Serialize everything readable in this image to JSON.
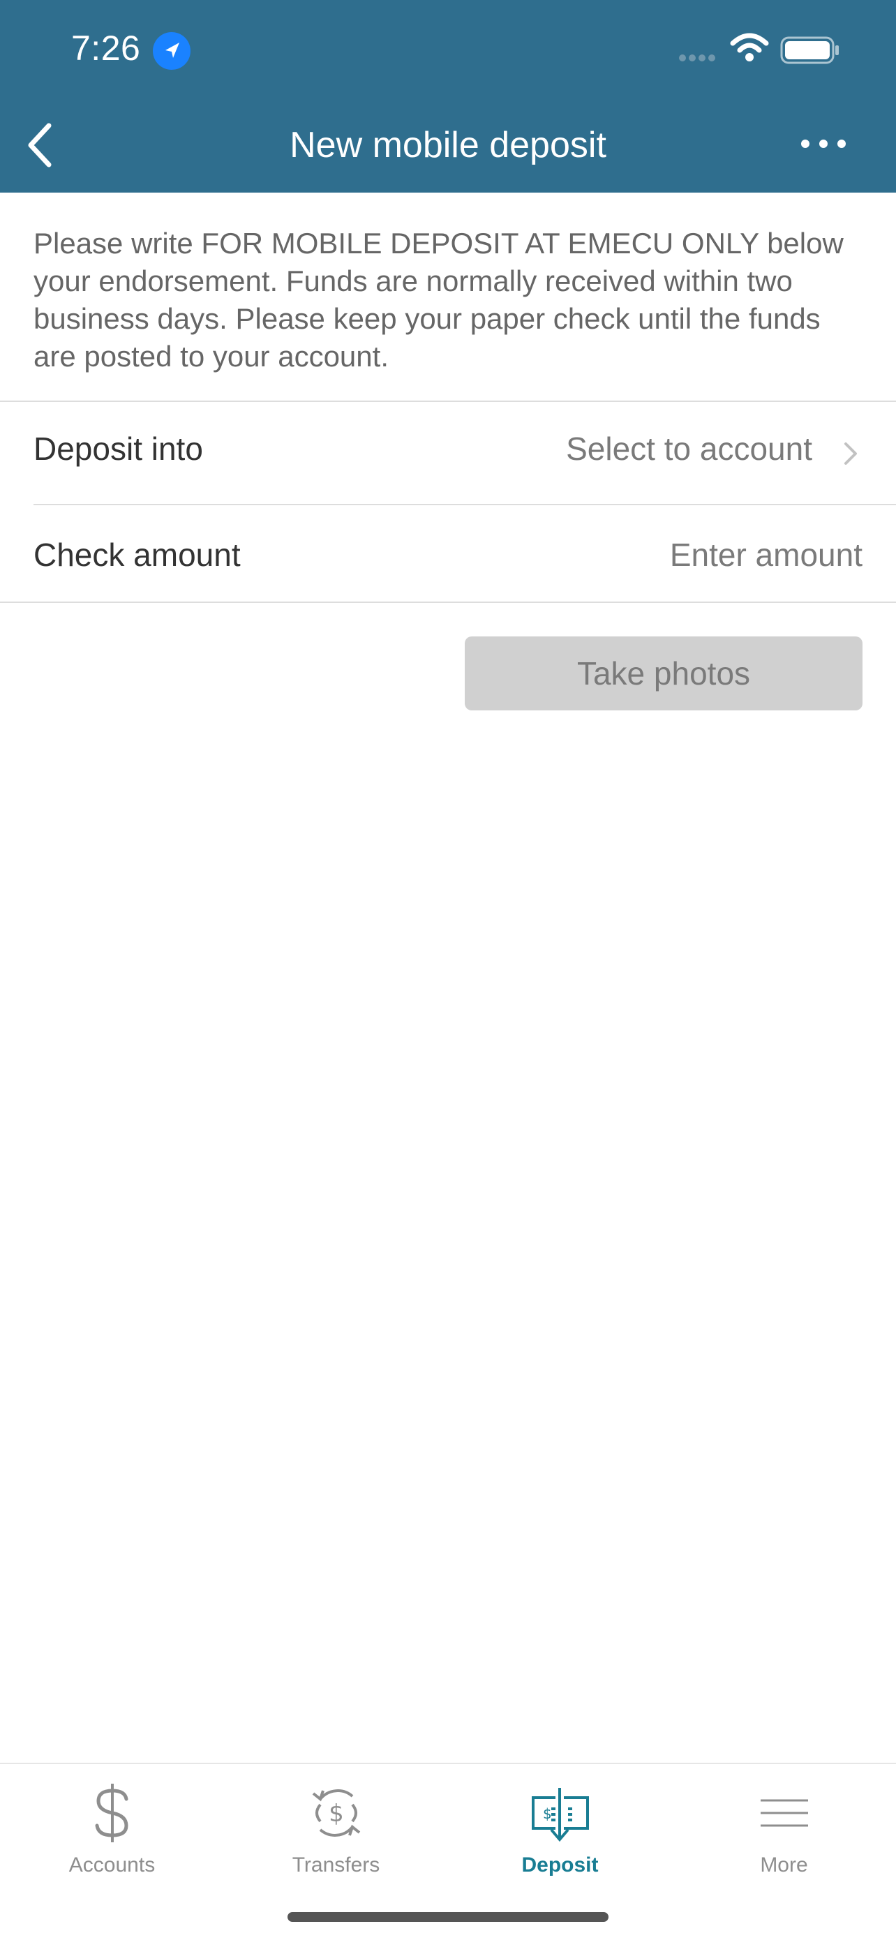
{
  "colors": {
    "brand": "#2f6e8e",
    "active_tab": "#197d93",
    "button_disabled": "#d0d0d0"
  },
  "status_bar": {
    "time": "7:26",
    "icons": [
      "location-arrow-icon",
      "signal-icon",
      "wifi-icon",
      "battery-icon"
    ]
  },
  "header": {
    "title": "New mobile deposit",
    "back_icon": "chevron-left-icon",
    "menu_icon": "ellipsis-icon"
  },
  "notice": {
    "text": "Please write FOR MOBILE DEPOSIT AT EMECU ONLY below your endorsement. Funds are normally received within two business days. Please keep your paper check until the funds are posted to your account."
  },
  "form": {
    "deposit_into": {
      "label": "Deposit into",
      "value": "Select to account"
    },
    "check_amount": {
      "label": "Check amount",
      "placeholder": "Enter amount"
    }
  },
  "actions": {
    "take_photos": "Take photos"
  },
  "tabbar": {
    "tabs": [
      {
        "label": "Accounts",
        "icon": "dollar-icon",
        "active": false
      },
      {
        "label": "Transfers",
        "icon": "transfer-dollar-icon",
        "active": false
      },
      {
        "label": "Deposit",
        "icon": "check-deposit-icon",
        "active": true
      },
      {
        "label": "More",
        "icon": "menu-lines-icon",
        "active": false
      }
    ]
  }
}
